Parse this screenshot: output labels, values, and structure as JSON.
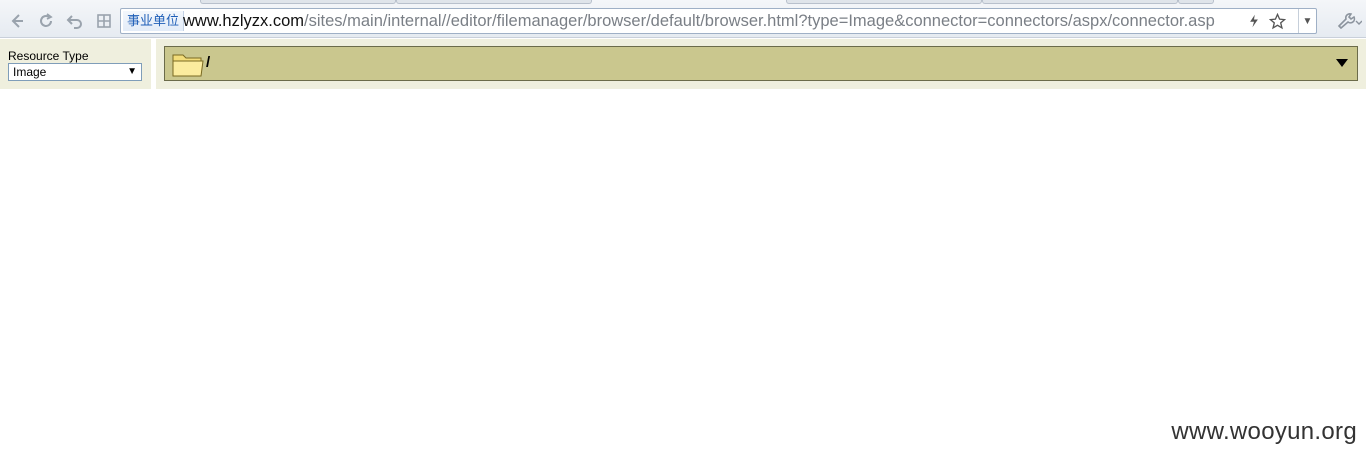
{
  "browser": {
    "site_badge": "事业单位",
    "url_host": "www.hzlyzx.com",
    "url_path": "/sites/main/internal//editor/filemanager/browser/default/browser.html?type=Image&connector=connectors/aspx/connector.asp",
    "icons": [
      "back-icon",
      "reload-icon",
      "undo-icon",
      "grid-icon",
      "bolt-icon",
      "star-icon",
      "dropdown-icon",
      "wrench-icon"
    ]
  },
  "file_manager": {
    "resource_type_label": "Resource Type",
    "resource_type_value": "Image",
    "current_folder": "/",
    "colors": {
      "panel_bg": "#efefde",
      "folder_bar_bg": "#cac78e",
      "folder_bar_border": "#6b6b4a"
    }
  },
  "watermark": "www.wooyun.org"
}
